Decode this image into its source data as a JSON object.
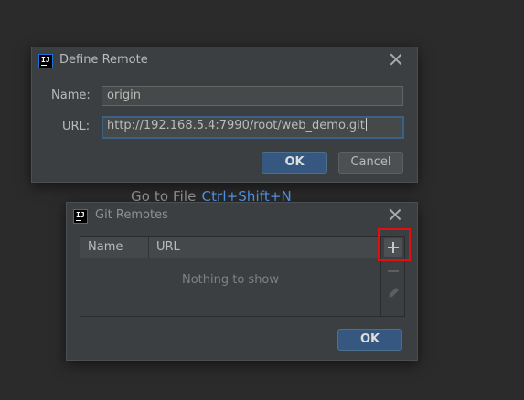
{
  "background": {
    "hint_text": "Go to File",
    "hint_shortcut": "Ctrl+Shift+N"
  },
  "define_remote": {
    "title": "Define Remote",
    "name_label": "Name:",
    "name_value": "origin",
    "url_label": "URL:",
    "url_value": "http://192.168.5.4:7990/root/web_demo.git",
    "ok_label": "OK",
    "cancel_label": "Cancel"
  },
  "git_remotes": {
    "title": "Git Remotes",
    "columns": [
      "Name",
      "URL"
    ],
    "empty_text": "Nothing to show",
    "ok_label": "OK"
  },
  "colors": {
    "background": "#2b2b2b",
    "dialog": "#3c3f41",
    "primary_button": "#365880",
    "focus_border": "#3d6185",
    "highlight": "#e01010",
    "link_blue": "#589df6"
  },
  "icons": {
    "app": "intellij-idea-icon",
    "close": "close-icon",
    "add": "plus-icon",
    "remove": "minus-icon",
    "edit": "pencil-icon"
  }
}
